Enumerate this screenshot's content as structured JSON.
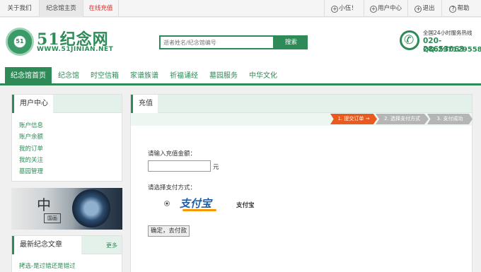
{
  "topbar": {
    "nav": [
      "关于我们",
      "纪念馆主页",
      "在线充值"
    ],
    "right": [
      {
        "icon": "plus-circle-icon",
        "label": "小伍！"
      },
      {
        "icon": "plus-circle-icon",
        "label": "用户中心"
      },
      {
        "icon": "plus-circle-icon",
        "label": "退出"
      },
      {
        "icon": "question-circle-icon",
        "label": "帮助"
      }
    ]
  },
  "header": {
    "logo_mark": "51",
    "logo_text": "51纪念网",
    "logo_url": "WWW.51JINIAN.NET",
    "search_placeholder": "逝者姓名/纪念馆编号",
    "search_button": "搜索",
    "hotline_label": "全国24小时服务热线",
    "hotline_number": "020-28653063",
    "hotline_qq": "QQ:2971295586"
  },
  "nav": [
    "纪念馆首页",
    "纪念馆",
    "时空信箱",
    "家谱族谱",
    "祈福诵经",
    "墓园服务",
    "中华文化"
  ],
  "user_center": {
    "title": "用户中心",
    "links": [
      "账户信息",
      "账户余额",
      "我的订单",
      "我的关注",
      "墓园管理"
    ]
  },
  "banner": {
    "char": "中",
    "stamp": "国画"
  },
  "latest": {
    "title": "最新纪念文章",
    "more": "更多",
    "items": [
      "拷选-是过错还是错过"
    ]
  },
  "recharge": {
    "tab": "充值",
    "steps": [
      "1. 提交订单 →",
      "2. 选择支付方式",
      "3. 支付成功"
    ],
    "amount_label": "请输入充值金额：",
    "amount_value": "",
    "unit": "元",
    "pay_label": "请选择支付方式：",
    "pay_logo": "支付宝",
    "pay_name": "支付宝",
    "confirm": "确定，去付款"
  },
  "colors": {
    "brand": "#2e8b57",
    "accent": "#e85a1e",
    "step_inactive": "#b5b5b5"
  }
}
